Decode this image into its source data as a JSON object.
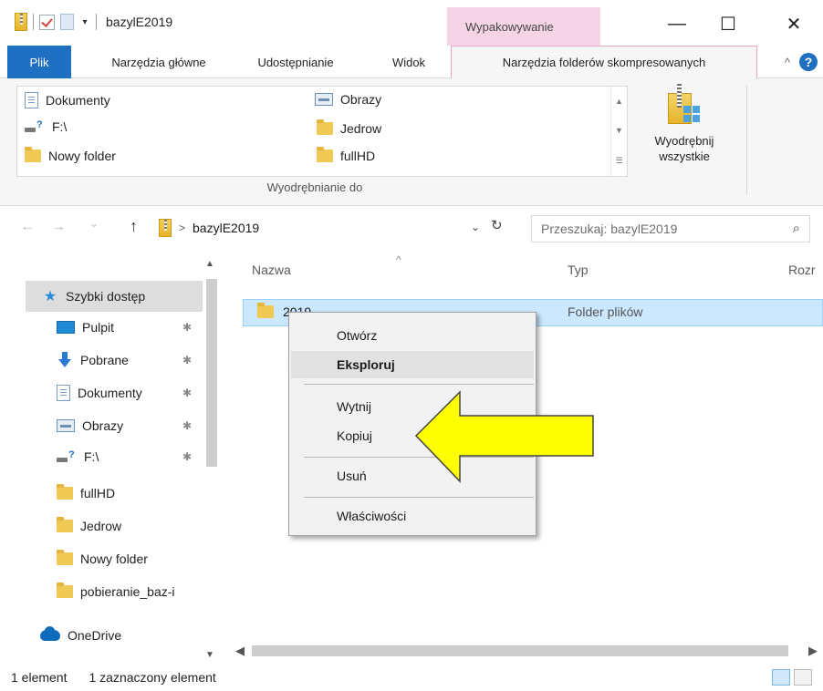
{
  "window": {
    "title": "bazylE2019",
    "contextual_tab_header": "Wypakowywanie",
    "minimize_glyph": "—",
    "maximize_glyph": "☐",
    "close_glyph": "✕"
  },
  "ribbon": {
    "tabs": [
      {
        "label": "Plik"
      },
      {
        "label": "Narzędzia główne"
      },
      {
        "label": "Udostępnianie"
      },
      {
        "label": "Widok"
      },
      {
        "label": "Narzędzia folderów skompresowanych"
      }
    ],
    "gallery": [
      {
        "label": "Dokumenty",
        "icon": "document-icon"
      },
      {
        "label": "F:\\",
        "icon": "drive-icon"
      },
      {
        "label": "Nowy folder",
        "icon": "folder-icon"
      },
      {
        "label": "Obrazy",
        "icon": "pictures-icon"
      },
      {
        "label": "Jedrow",
        "icon": "folder-icon"
      },
      {
        "label": "fullHD",
        "icon": "folder-icon"
      }
    ],
    "group_label": "Wyodrębnianie do",
    "extract_all_line1": "Wyodrębnij",
    "extract_all_line2": "wszystkie",
    "collapse_glyph": "^",
    "help_glyph": "?"
  },
  "address": {
    "back_glyph": "←",
    "forward_glyph": "→",
    "recent_glyph": "⌄",
    "up_glyph": "↑",
    "crumb_sep": ">",
    "path": "bazylE2019",
    "search_placeholder": "Przeszukaj: bazylE2019"
  },
  "sidebar": {
    "quick_access": "Szybki dostęp",
    "items": [
      {
        "label": "Pulpit",
        "icon": "desktop-icon",
        "pinned": true
      },
      {
        "label": "Pobrane",
        "icon": "downloads-icon",
        "pinned": true
      },
      {
        "label": "Dokumenty",
        "icon": "document-icon",
        "pinned": true
      },
      {
        "label": "Obrazy",
        "icon": "pictures-icon",
        "pinned": true
      },
      {
        "label": "F:\\",
        "icon": "drive-icon",
        "pinned": true
      },
      {
        "label": "fullHD",
        "icon": "folder-icon",
        "pinned": false
      },
      {
        "label": "Jedrow",
        "icon": "folder-icon",
        "pinned": false
      },
      {
        "label": "Nowy folder",
        "icon": "folder-icon",
        "pinned": false
      },
      {
        "label": "pobieranie_baz-i",
        "icon": "folder-icon",
        "pinned": false
      }
    ],
    "onedrive": "OneDrive"
  },
  "list": {
    "columns": {
      "name": "Nazwa",
      "type": "Typ",
      "size": "Rozr"
    },
    "rows": [
      {
        "name": "2019",
        "type": "Folder plików"
      }
    ]
  },
  "context_menu": {
    "items": [
      "Otwórz",
      "Eksploruj",
      "Wytnij",
      "Kopiuj",
      "Usuń",
      "Właściwości"
    ]
  },
  "status": {
    "count": "1 element",
    "selected": "1 zaznaczony element"
  },
  "colors": {
    "file_tab": "#1f6fc2",
    "contextual_tab": "#f7d3e6",
    "selection": "#cce8ff",
    "arrow": "#ffff00"
  }
}
